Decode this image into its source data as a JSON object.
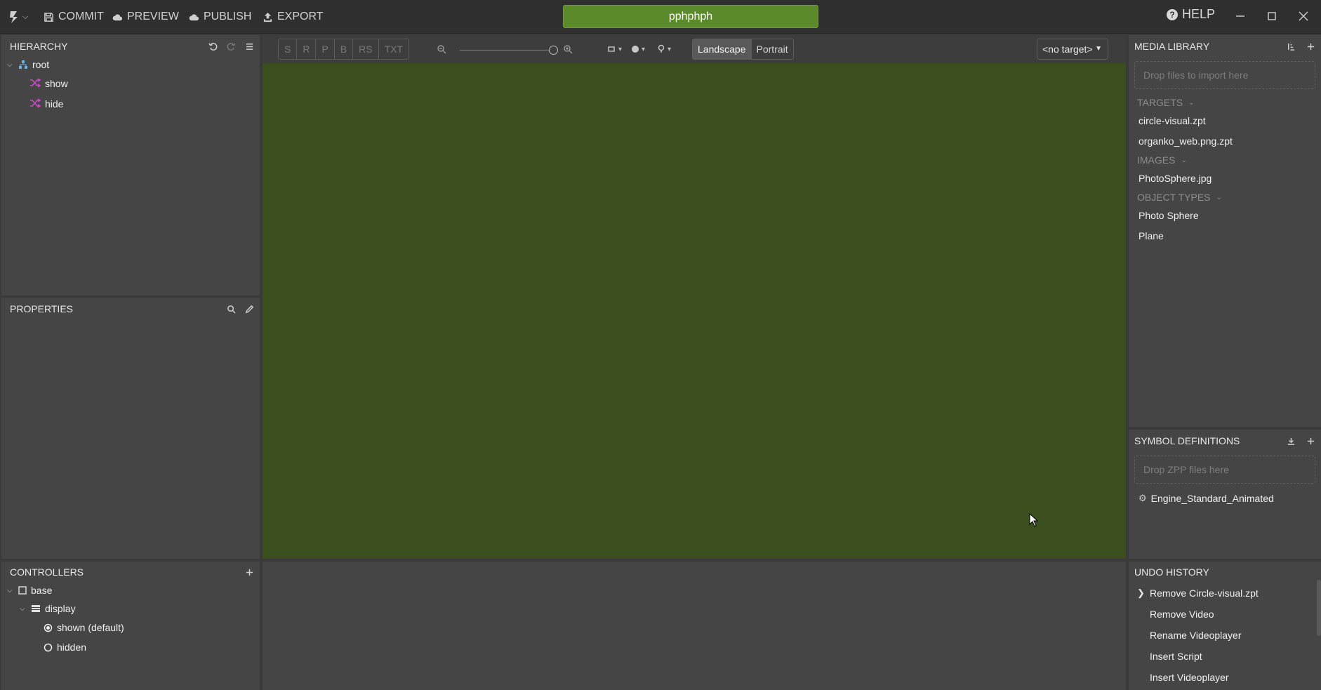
{
  "topbar": {
    "commit": "COMMIT",
    "preview": "PREVIEW",
    "publish": "PUBLISH",
    "export": "EXPORT",
    "project_name": "pphphph",
    "help": "HELP"
  },
  "hierarchy": {
    "title": "HIERARCHY",
    "root": "root",
    "items": [
      "show",
      "hide"
    ]
  },
  "properties": {
    "title": "PROPERTIES"
  },
  "controllers": {
    "title": "CONTROLLERS",
    "base": "base",
    "display": "display",
    "states": [
      "shown (default)",
      "hidden"
    ]
  },
  "canvas": {
    "modes": [
      "S",
      "R",
      "P",
      "B",
      "RS",
      "TXT"
    ],
    "landscape": "Landscape",
    "portrait": "Portrait",
    "target": "<no target>",
    "stage_color": "#3a4f1d"
  },
  "media_library": {
    "title": "MEDIA LIBRARY",
    "drop_hint": "Drop files to import here",
    "targets_label": "TARGETS",
    "targets": [
      "circle-visual.zpt",
      "organko_web.png.zpt"
    ],
    "images_label": "IMAGES",
    "images": [
      "PhotoSphere.jpg"
    ],
    "object_types_label": "OBJECT TYPES",
    "object_types": [
      "Photo Sphere",
      "Plane"
    ]
  },
  "symbol_definitions": {
    "title": "SYMBOL DEFINITIONS",
    "drop_hint": "Drop ZPP files here",
    "items": [
      "Engine_Standard_Animated"
    ]
  },
  "undo_history": {
    "title": "UNDO HISTORY",
    "items": [
      "Remove Circle-visual.zpt",
      "Remove Video",
      "Rename Videoplayer",
      "Insert Script",
      "Insert Videoplayer"
    ]
  },
  "colors": {
    "accent": "#5b8a2b",
    "panel": "#454545",
    "topbar": "#2f2f2f"
  }
}
